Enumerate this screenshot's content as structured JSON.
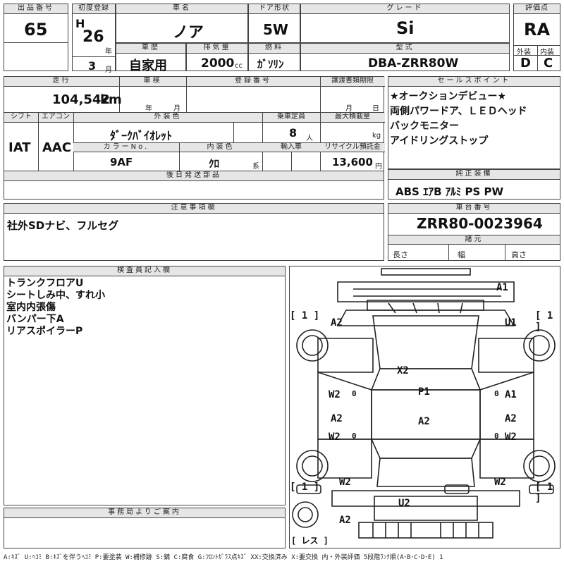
{
  "headers": {
    "lot_no": "出品番号",
    "first_reg": "初度登録",
    "car_name": "車名",
    "door_type": "ドア形状",
    "grade": "グレード",
    "score": "評価点",
    "history": "車歴",
    "displacement": "排気量",
    "fuel": "燃料",
    "model": "型式",
    "exterior": "外装",
    "interior": "内装",
    "mileage": "走行",
    "inspection": "車検",
    "reg_no": "登録番号",
    "transfer_doc": "譲渡書類期限",
    "sales_point": "セールスポイント",
    "shift": "シフト",
    "ac": "エアコン",
    "ext_color": "外装色",
    "capacity": "乗車定員",
    "max_load": "最大積載量",
    "color_no": "カラーNo.",
    "int_color": "内装色",
    "import": "輸入車",
    "recycle": "リサイクル預託金",
    "later_parts": "後日発送部品",
    "equipment": "純正装備",
    "notes": "注意事項欄",
    "chassis": "車台番号",
    "specs": "諸元",
    "inspector": "検査員記入欄",
    "office": "事務局よりご案内"
  },
  "lot_number": "65",
  "first_reg": {
    "era": "H",
    "year": "26",
    "year_unit": "年",
    "month": "3",
    "month_unit": "月"
  },
  "car_name": "ノア",
  "door_type": "5W",
  "grade": "Si",
  "score": "RA",
  "history": "自家用",
  "displacement": "2000",
  "displacement_unit": "cc",
  "fuel": "ｶﾞｿﾘﾝ",
  "model": "DBA-ZRR80W",
  "exterior_grade": "D",
  "interior_grade": "C",
  "mileage": "104,542",
  "mileage_unit": "km",
  "inspection": {
    "year_unit": "年",
    "month_unit": "月"
  },
  "transfer_doc": {
    "month_unit": "月",
    "day_unit": "日"
  },
  "sales_points": [
    "★オークションデビュー★",
    "両側パワードア、ＬＥＤヘッド",
    "バックモニター",
    "アイドリングストップ"
  ],
  "shift": "IAT",
  "ac": "AAC",
  "ext_color": "ﾀﾞｰｸﾊﾞｲｵﾚｯﾄ",
  "capacity": "8",
  "capacity_unit": "人",
  "max_load_unit": "kg",
  "color_no": "9AF",
  "int_color": "ｸﾛ",
  "int_color_unit": "系",
  "recycle": "13,600",
  "recycle_unit": "円",
  "equipment": "ABS ｴｱB ｱﾙﾐ PS PW",
  "notes_text": "社外SDナビ、フルセグ",
  "chassis_no": "ZRR80-0023964",
  "specs": {
    "length": "長さ",
    "width": "幅",
    "height": "高さ"
  },
  "inspector_notes": [
    "トランクフロアU",
    "シートしみ中、すれ小",
    "室内内張傷",
    "バンパー下A",
    "リアスポイラーP"
  ],
  "damage_marks": {
    "a1_top": "A1",
    "a2_fl": "A2",
    "u1_fr": "U1",
    "x2": "X2",
    "p1": "P1",
    "w2_l1": "W2",
    "a1_r1": "A1",
    "a2_c": "A2",
    "a2_l2": "A2",
    "a2_r2": "A2",
    "w2_l2": "W2",
    "w2_r2": "W2",
    "w2_rl": "W2",
    "w2_rr": "W2",
    "u2": "U2",
    "a2_spare": "A2",
    "zero_l": "0",
    "zero_r": "0",
    "zero_l2": "0",
    "zero_r2": "0"
  },
  "tire_marks": {
    "fl": "[ 1 ]",
    "fr": "[ 1 ]",
    "rl": "[ 1 ]",
    "rr": "[ 1 ]",
    "spare": "[ レス ]"
  },
  "legend": "A:ｷｽﾞ U:ﾍｺﾐ B:ｷｽﾞを伴うﾍｺﾐ P:要塗装 W:補修跡 S:錆 C:腐食 G:ﾌﾛﾝﾄｶﾞﾗｽ点ｷｽﾞ XX:交換済み X:要交換 内・外装評価 5段階ﾗﾝｸ順(A･B･C･D･E) 1"
}
